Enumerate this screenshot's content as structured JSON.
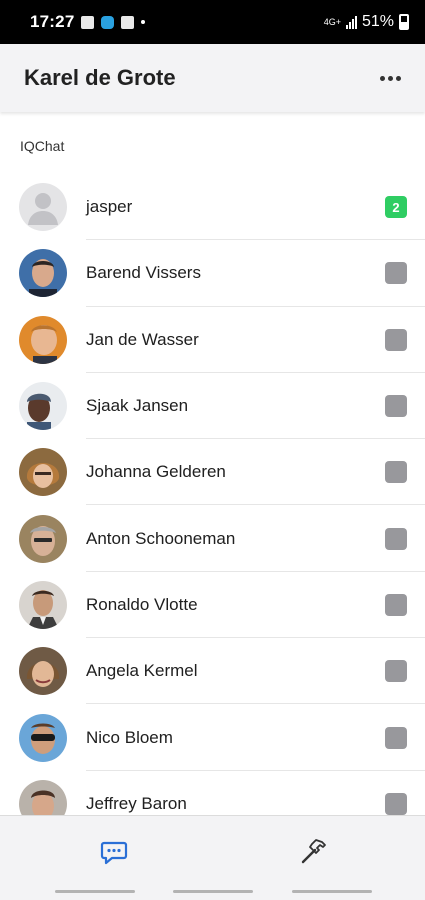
{
  "status_bar": {
    "time": "17:27",
    "network_label": "4G+",
    "battery": "51%"
  },
  "header": {
    "title": "Karel de Grote",
    "menu_icon": "more-horizontal-icon"
  },
  "section": {
    "label": "IQChat"
  },
  "contacts": [
    {
      "name": "jasper",
      "badge": "2",
      "unread": true
    },
    {
      "name": "Barend Vissers",
      "badge": "",
      "unread": false
    },
    {
      "name": "Jan de Wasser",
      "badge": "",
      "unread": false
    },
    {
      "name": "Sjaak Jansen",
      "badge": "",
      "unread": false
    },
    {
      "name": "Johanna Gelderen",
      "badge": "",
      "unread": false
    },
    {
      "name": "Anton Schooneman",
      "badge": "",
      "unread": false
    },
    {
      "name": "Ronaldo Vlotte",
      "badge": "",
      "unread": false
    },
    {
      "name": "Angela Kermel",
      "badge": "",
      "unread": false
    },
    {
      "name": "Nico Bloem",
      "badge": "",
      "unread": false
    },
    {
      "name": "Jeffrey Baron",
      "badge": "",
      "unread": false
    }
  ],
  "bottom_nav": {
    "chat_icon": "chat-bubble-icon",
    "tools_icon": "hammer-icon"
  },
  "colors": {
    "unread_badge": "#2fcd63",
    "idle_badge": "#98989c",
    "chat_icon": "#2a6fd6",
    "header_bg": "#f3f3f5"
  }
}
